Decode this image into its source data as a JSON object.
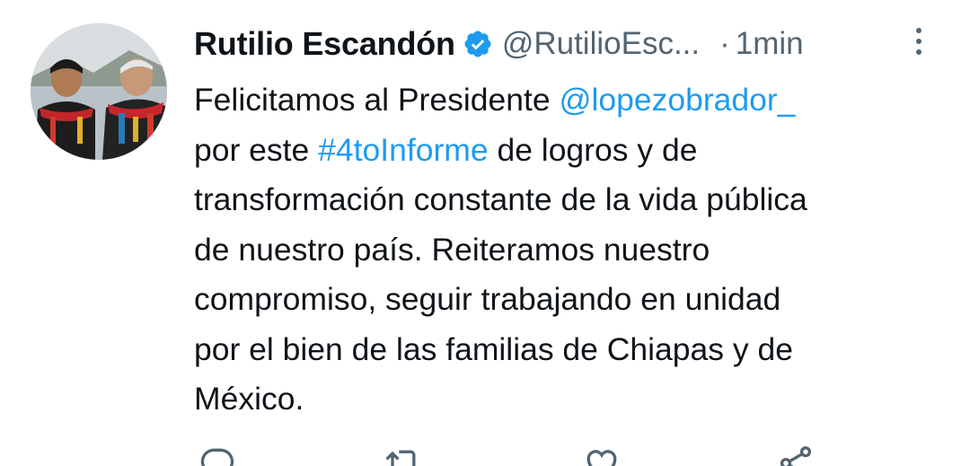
{
  "tweet": {
    "author_name": "Rutilio Escandón",
    "handle": "@RutilioEsc...",
    "separator": "·",
    "time": "1min",
    "verified_icon": "verified-badge-icon",
    "lines": [
      [
        {
          "t": "Felicitamos al Presidente ",
          "link": false
        },
        {
          "t": "@lopezobrador_",
          "link": true
        }
      ],
      [
        {
          "t": "por este ",
          "link": false
        },
        {
          "t": "#4toInforme",
          "link": true
        },
        {
          "t": " de logros y de",
          "link": false
        }
      ],
      [
        {
          "t": "transformación constante de la vida pública",
          "link": false
        }
      ],
      [
        {
          "t": "de nuestro país. Reiteramos nuestro",
          "link": false
        }
      ],
      [
        {
          "t": "compromiso, seguir trabajando en unidad",
          "link": false
        }
      ],
      [
        {
          "t": "por el bien de las familias de Chiapas y de",
          "link": false
        }
      ],
      [
        {
          "t": "México.",
          "link": false
        }
      ]
    ],
    "actions": [
      "reply-icon",
      "retweet-icon",
      "like-icon",
      "share-icon"
    ]
  },
  "colors": {
    "text": "#0f1419",
    "secondary": "#536471",
    "link": "#1d9bf0",
    "verified": "#1d9bf0"
  }
}
